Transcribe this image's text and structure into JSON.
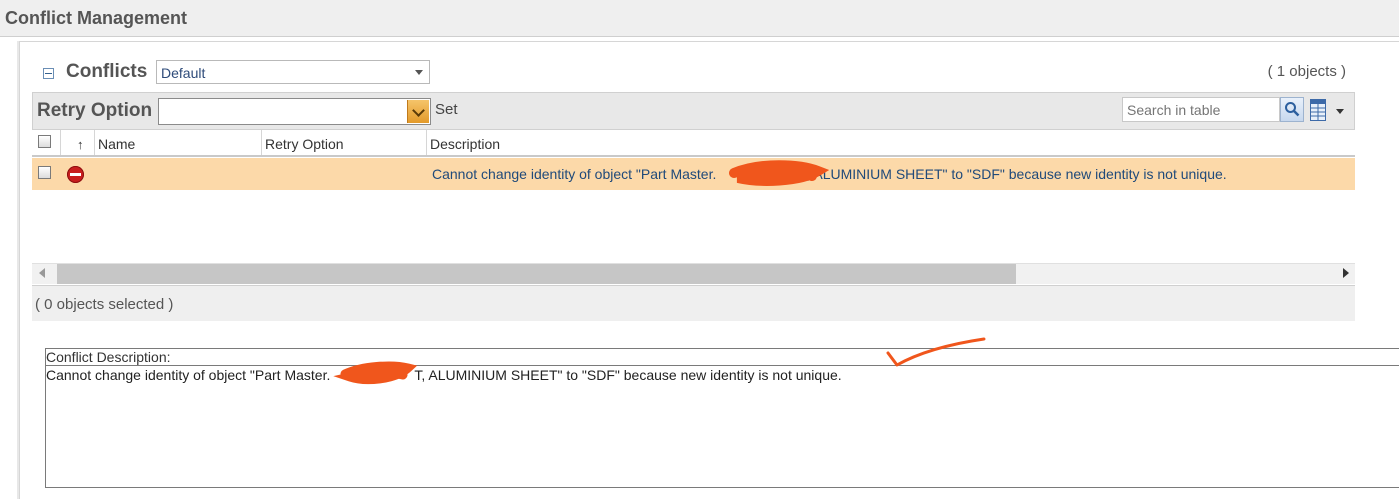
{
  "header": {
    "title": "Conflict Management"
  },
  "conflicts_panel": {
    "title": "Conflicts",
    "view_select": {
      "value": "Default"
    },
    "object_count": "( 1 objects )"
  },
  "toolbar": {
    "retry_label": "Retry Option",
    "retry_value": "",
    "set_label": "Set",
    "search_placeholder": "Search in table"
  },
  "table": {
    "columns": [
      {
        "label": ""
      },
      {
        "label": "↑"
      },
      {
        "label": "Name"
      },
      {
        "label": "Retry Option"
      },
      {
        "label": "Description"
      }
    ],
    "rows": [
      {
        "status_icon": "error-icon",
        "name": "",
        "retry_option": "",
        "description": "Cannot change identity of object \"Part Master.",
        "description_after_redaction": ", ALUMINIUM SHEET\" to \"SDF\" because new identity is not unique."
      }
    ],
    "selected_count": "( 0 objects selected )"
  },
  "conflict_description": {
    "label": "Conflict Description:",
    "text": "Cannot change identity of object \"Part Master.",
    "text_after_redaction": "T, ALUMINIUM SHEET\" to \"SDF\" because new identity is not unique."
  },
  "colors": {
    "row_highlight": "#fcd9a9",
    "annotation": "#f0561c",
    "link_text": "#204a7a"
  }
}
